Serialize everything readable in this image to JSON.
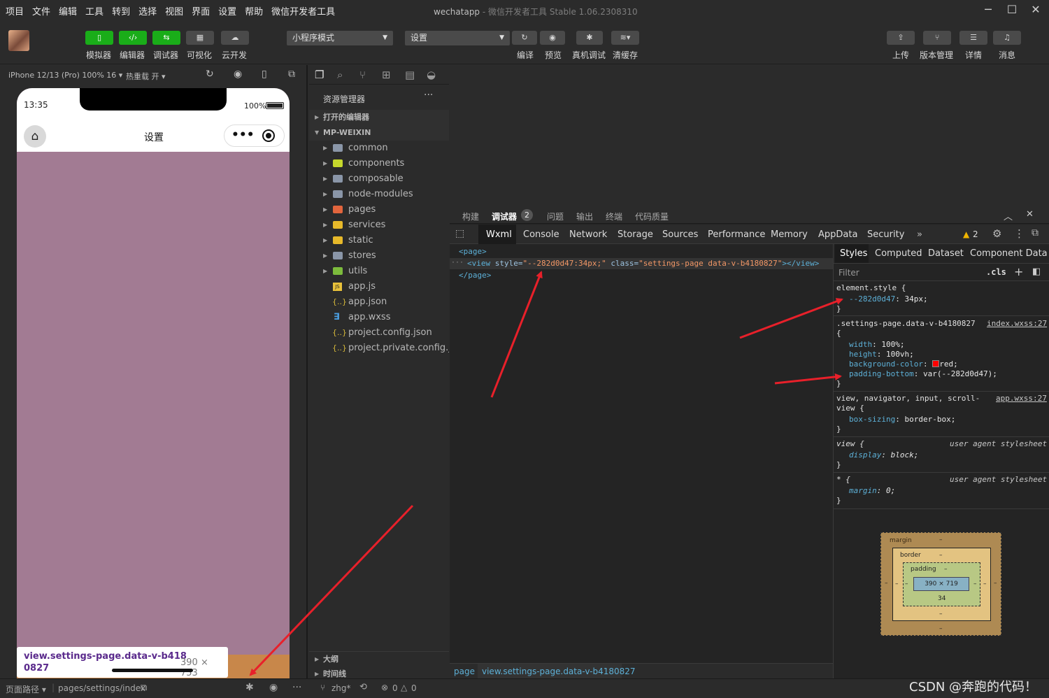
{
  "menu": [
    "项目",
    "文件",
    "编辑",
    "工具",
    "转到",
    "选择",
    "视图",
    "界面",
    "设置",
    "帮助",
    "微信开发者工具"
  ],
  "window": {
    "title": "wechatapp",
    "subtitle": "- 微信开发者工具 Stable 1.06.2308310"
  },
  "toolbar": {
    "left": [
      "模拟器",
      "编辑器",
      "调试器",
      "可视化",
      "云开发"
    ],
    "mode_select": "小程序模式",
    "compile_select": "设置",
    "center": [
      "编译",
      "预览",
      "真机调试",
      "清缓存"
    ],
    "right": [
      "上传",
      "版本管理",
      "详情",
      "消息"
    ]
  },
  "simulator": {
    "device": "iPhone 12/13 (Pro) 100% 16",
    "hot_reload": "热重载 开",
    "time": "13:35",
    "battery": "100%",
    "nav_title": "设置",
    "tooltip_name_1": "view.settings-page.data-v-b418",
    "tooltip_name_2": "0827",
    "tooltip_size": "390 × 753"
  },
  "explorer": {
    "title": "资源管理器",
    "open_editors": "打开的编辑器",
    "root": "MP-WEIXIN",
    "folders": [
      "common",
      "components",
      "composable",
      "node-modules",
      "pages",
      "services",
      "static",
      "stores",
      "utils"
    ],
    "files": [
      "app.js",
      "app.json",
      "app.wxss",
      "project.config.json",
      "project.private.config.js..."
    ],
    "outline": "大纲",
    "timeline": "时间线"
  },
  "devtools": {
    "top_tabs": [
      "构建",
      "调试器",
      "问题",
      "输出",
      "终端",
      "代码质量"
    ],
    "debugger_badge": "2",
    "tabs": [
      "Wxml",
      "Console",
      "Network",
      "Storage",
      "Sources",
      "Performance",
      "Memory",
      "AppData",
      "Security"
    ],
    "warnings": "2",
    "wxml": {
      "line1": "<page>",
      "line2_tag": "<view ",
      "line2_attr1": "style=",
      "line2_val1": "\"--282d0d47:34px;\"",
      "line2_attr2": " class=",
      "line2_val2": "\"settings-page data-v-b4180827\"",
      "line2_end": "></view>",
      "line3": "</page>"
    },
    "breadcrumb": [
      "page",
      "view.settings-page.data-v-b4180827"
    ],
    "style_tabs": [
      "Styles",
      "Computed",
      "Dataset",
      "Component Data"
    ],
    "filter_placeholder": "Filter",
    "cls": ".cls",
    "rules": {
      "element_selector": "element.style {",
      "element_prop": "--282d0d47",
      "element_val": "34px;",
      "settings_selector": ".settings-page.data-v-b4180827",
      "settings_src": "index.wxss:27",
      "width": "100%;",
      "height": "100vh;",
      "bg": "red;",
      "pad": "var(--282d0d47);",
      "view_selector": "view, navigator, input, scroll-",
      "view_selector2": "view {",
      "view_src": "app.wxss:27",
      "box_sizing": "border-box;",
      "ua1": "view {",
      "display": "block;",
      "ua_label": "user agent stylesheet",
      "ua2": "* {",
      "margin": "0;"
    },
    "box_model": {
      "margin": "margin",
      "border": "border",
      "padding": "padding",
      "content": "390 × 719",
      "dash": "–",
      "padding_bottom": "34"
    }
  },
  "statusbar": {
    "page_path_label": "页面路径",
    "page_path": "pages/settings/index",
    "branch": "zhg*",
    "errors": "0",
    "warnings": "0",
    "watermark": "CSDN @奔跑的代码！"
  }
}
